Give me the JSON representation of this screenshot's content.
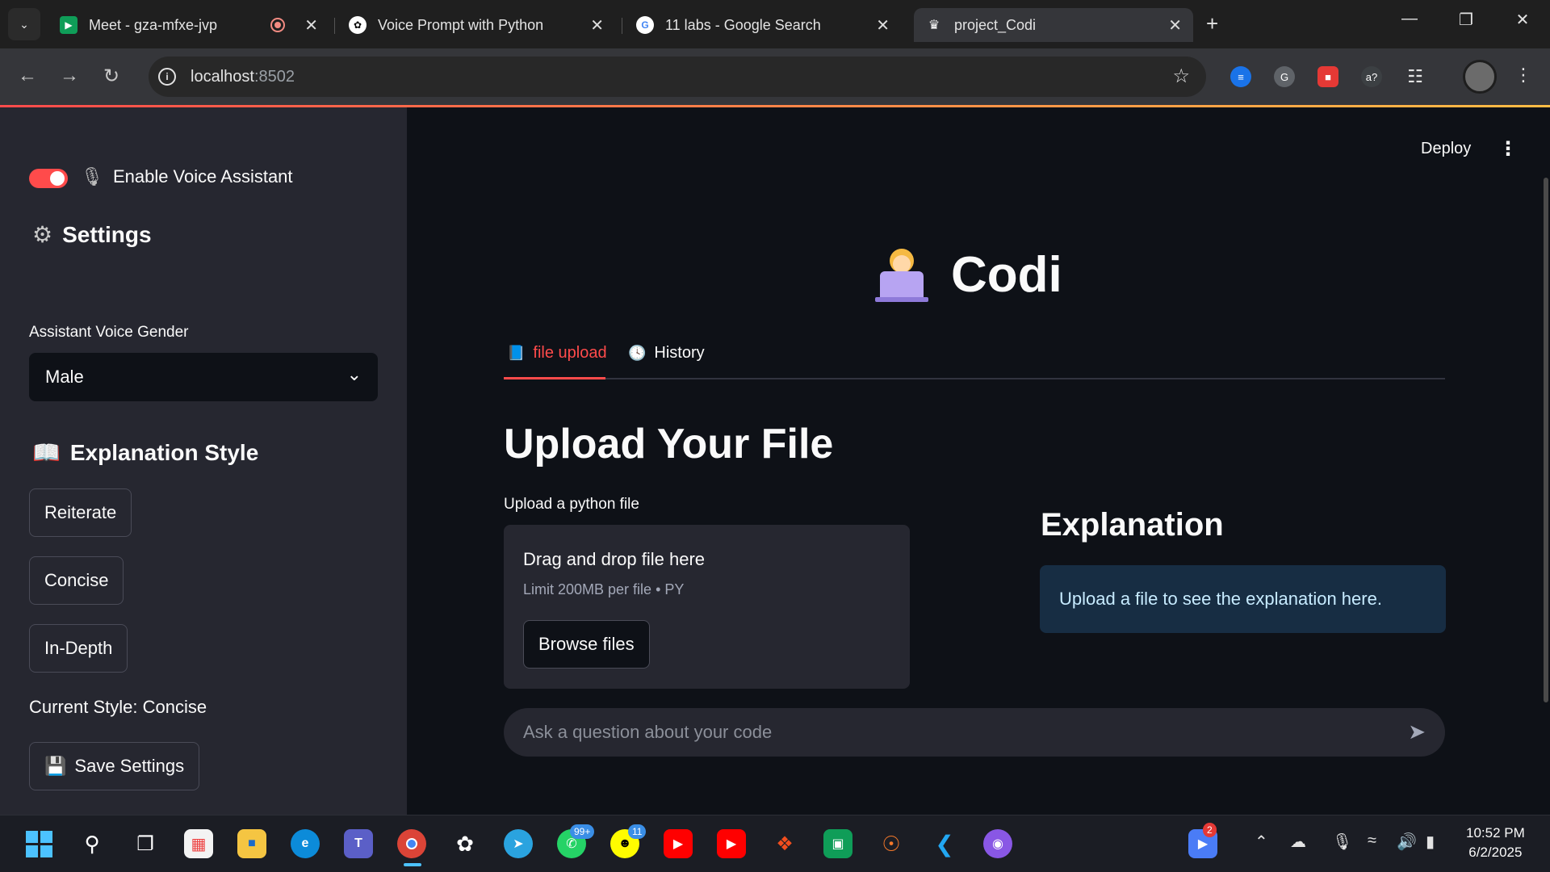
{
  "browser": {
    "tabs": [
      {
        "title": "Meet - gza-mfxe-jvp",
        "active": false
      },
      {
        "title": "Voice Prompt with Python",
        "active": false
      },
      {
        "title": "11 labs - Google Search",
        "active": false
      },
      {
        "title": "project_Codi",
        "active": true
      }
    ],
    "url_host": "localhost",
    "url_port": ":8502"
  },
  "sidebar": {
    "settings_heading": "Settings",
    "voice_toggle_label": "Enable Voice Assistant",
    "voice_enabled": true,
    "gender_label": "Assistant Voice Gender",
    "gender_value": "Male",
    "style_heading": "Explanation Style",
    "style_buttons": [
      "Reiterate",
      "Concise",
      "In-Depth"
    ],
    "current_style": "Current Style: Concise",
    "save_label": "Save Settings"
  },
  "header": {
    "deploy_label": "Deploy"
  },
  "main": {
    "app_title": "Codi",
    "tabs": [
      {
        "label": "file upload",
        "active": true
      },
      {
        "label": "History",
        "active": false
      }
    ],
    "heading": "Upload Your File",
    "uploader_label": "Upload a python file",
    "dropzone_title": "Drag and drop file here",
    "dropzone_limit": "Limit 200MB per file • PY",
    "browse_label": "Browse files",
    "explanation_heading": "Explanation",
    "explanation_text": "Upload a file to see the explanation here.",
    "chat_placeholder": "Ask a question about your code"
  },
  "taskbar": {
    "whatsapp_badge": "99+",
    "snapchat_badge": "11",
    "zoom_badge": "2",
    "time": "10:52 PM",
    "date": "6/2/2025"
  },
  "colors": {
    "accent": "#ff4b4b",
    "sidebar_bg": "#262730",
    "main_bg": "#0e1117",
    "info_bg": "#172d43"
  }
}
